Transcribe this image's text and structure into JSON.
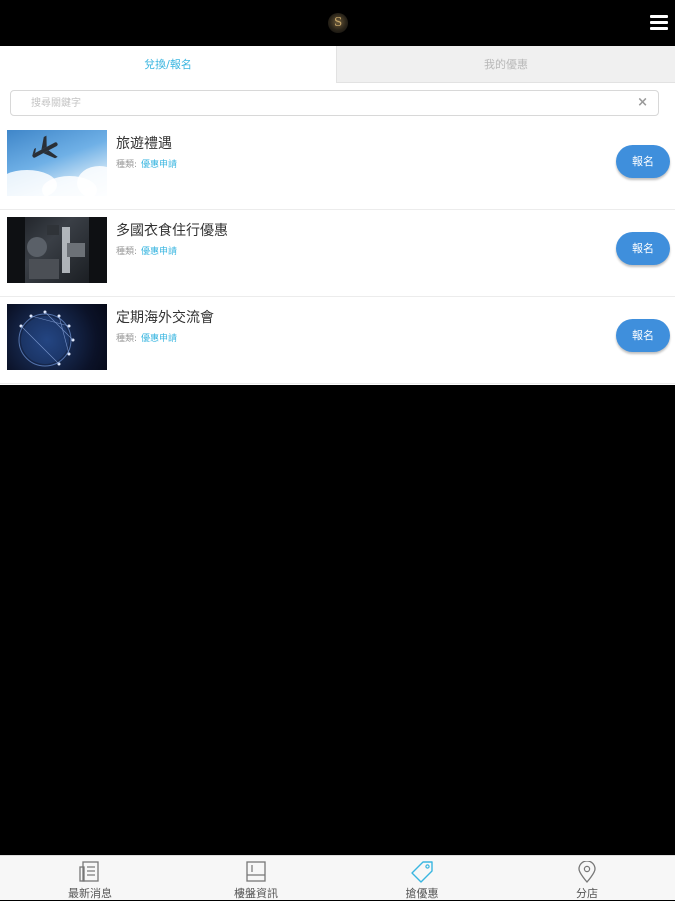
{
  "header": {
    "logo": "S",
    "menu_icon": "hamburger-menu-icon"
  },
  "tabs": [
    {
      "label": "兌換/報名",
      "active": true
    },
    {
      "label": "我的優惠",
      "active": false
    }
  ],
  "search": {
    "placeholder": "搜尋關鍵字",
    "value": "",
    "clear_icon": "×"
  },
  "offers": [
    {
      "title": "旅遊禮遇",
      "meta_label": "種類:",
      "meta_value": "優惠申請",
      "button": "報名",
      "thumb": "airplane-sky"
    },
    {
      "title": "多國衣食住行優惠",
      "meta_label": "種類:",
      "meta_value": "優惠申請",
      "button": "報名",
      "thumb": "city-street"
    },
    {
      "title": "定期海外交流會",
      "meta_label": "種類:",
      "meta_value": "優惠申請",
      "button": "報名",
      "thumb": "globe-network"
    }
  ],
  "bottom_nav": [
    {
      "label": "最新消息",
      "icon": "news-icon"
    },
    {
      "label": "樓盤資訊",
      "icon": "property-icon"
    },
    {
      "label": "搶優惠",
      "icon": "tag-icon",
      "active": true
    },
    {
      "label": "分店",
      "icon": "location-pin-icon"
    }
  ],
  "colors": {
    "accent": "#3ab6e0",
    "button": "#3f8fdc",
    "background": "#000000",
    "tag_active": "#3ab6e0"
  }
}
